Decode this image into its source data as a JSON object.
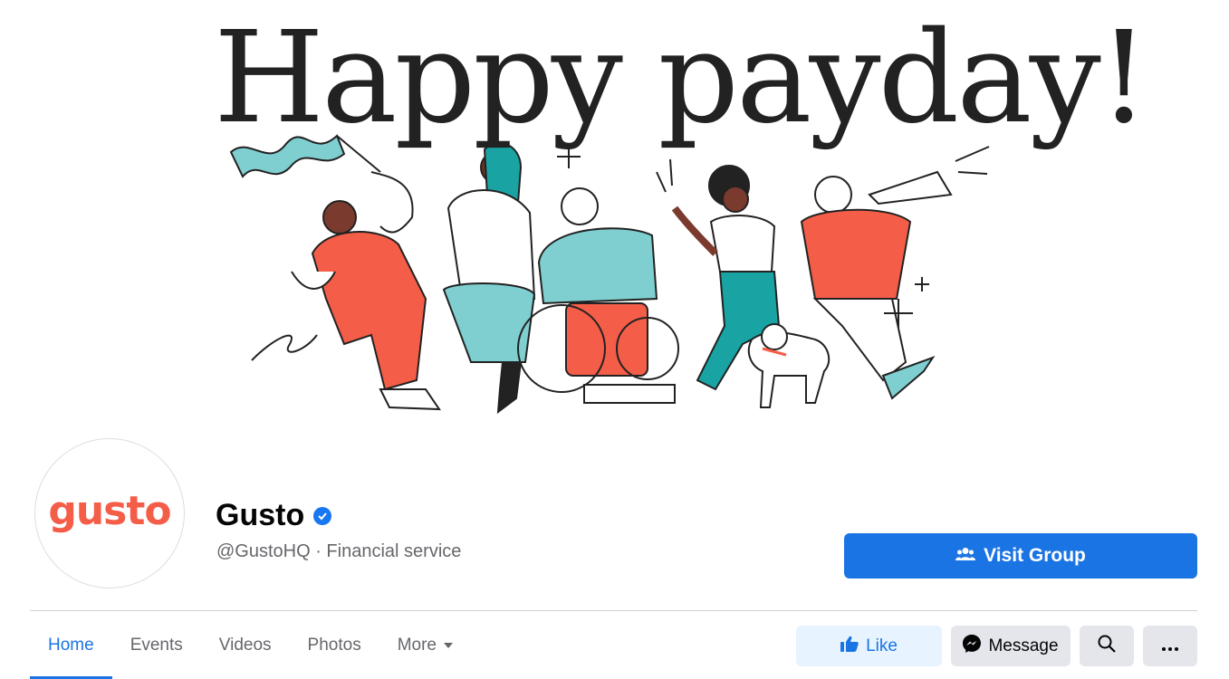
{
  "cover": {
    "headline": "Happy payday!"
  },
  "profile": {
    "logo_text": "gusto",
    "name": "Gusto",
    "subtitle": "@GustoHQ · Financial service",
    "visit_label": "Visit Group"
  },
  "tabs": [
    {
      "label": "Home"
    },
    {
      "label": "Events"
    },
    {
      "label": "Videos"
    },
    {
      "label": "Photos"
    },
    {
      "label": "More"
    }
  ],
  "actions": {
    "like_label": "Like",
    "message_label": "Message"
  },
  "colors": {
    "brand_blue": "#1b74e4",
    "gusto_coral": "#f45d48",
    "teal": "#7fcfd1",
    "text_secondary": "#65676b"
  }
}
